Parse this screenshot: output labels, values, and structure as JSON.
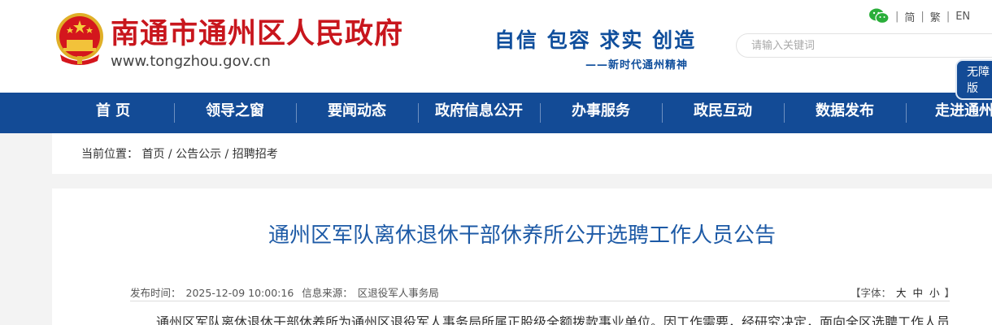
{
  "header": {
    "site_name": "南通市通州区人民政府",
    "site_url": "www.tongzhou.gov.cn",
    "slogan": "自信  包容  求实  创造",
    "slogan_sub": "——新时代通州精神",
    "search_placeholder": "请输入关键词",
    "links": [
      "简",
      "繁",
      "EN"
    ],
    "accessibility_label_1": "无障",
    "accessibility_label_2": "版"
  },
  "nav": {
    "items": [
      "首 页",
      "领导之窗",
      "要闻动态",
      "政府信息公开",
      "办事服务",
      "政民互动",
      "数据发布",
      "走进通州"
    ]
  },
  "breadcrumb": {
    "prefix": "当前位置：",
    "items": [
      "首页",
      "公告公示",
      "招聘招考"
    ],
    "separator": " / "
  },
  "article": {
    "title": "通州区军队离休退休干部休养所公开选聘工作人员公告",
    "publish_label": "发布时间：",
    "publish_time": "2025-12-09 10:00:16",
    "source_label": "信息来源：",
    "source": "区退役军人事务局",
    "font_label": "【字体：",
    "font_sizes": [
      "大",
      "中",
      "小"
    ],
    "font_close": "】",
    "body_first_line": "通州区军队离休退休干部休养所为通州区退役军人事务局所属正股级全额拨款事业单位。因工作需要，经研究决定，面向全区选聘工作人员"
  },
  "colors": {
    "brand_red": "#c8161d",
    "nav_blue": "#134b96",
    "title_blue": "#1d5aa6"
  }
}
